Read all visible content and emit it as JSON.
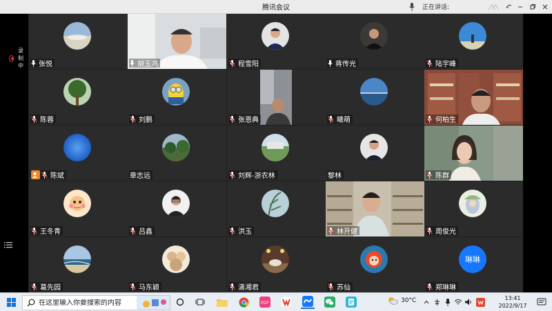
{
  "window": {
    "title": "腾讯会议",
    "speaking_label": "正在讲话:"
  },
  "recording": {
    "label": "录制中"
  },
  "participants": [
    {
      "name": "张悦",
      "mic": "on"
    },
    {
      "name": "胡玉鸿",
      "mic": "on"
    },
    {
      "name": "程雪阳",
      "mic": "muted"
    },
    {
      "name": "蒋传光",
      "mic": "on"
    },
    {
      "name": "陆宇峰",
      "mic": "muted"
    },
    {
      "name": "陈蓉",
      "mic": "muted"
    },
    {
      "name": "刘鹏",
      "mic": "muted"
    },
    {
      "name": "张恩典",
      "mic": "muted"
    },
    {
      "name": "曦萌",
      "mic": "muted"
    },
    {
      "name": "何柏生",
      "mic": "muted"
    },
    {
      "name": "陈斌",
      "mic": "muted"
    },
    {
      "name": "章志远",
      "mic": "none"
    },
    {
      "name": "刘辉-浙农林",
      "mic": "muted"
    },
    {
      "name": "黎林",
      "mic": "none"
    },
    {
      "name": "陈群",
      "mic": "muted"
    },
    {
      "name": "王冬青",
      "mic": "muted"
    },
    {
      "name": "吕鑫",
      "mic": "muted"
    },
    {
      "name": "洪玉",
      "mic": "muted"
    },
    {
      "name": "林开健",
      "mic": "muted"
    },
    {
      "name": "周俊光",
      "mic": "muted"
    },
    {
      "name": "葛先园",
      "mic": "muted"
    },
    {
      "name": "马东颖",
      "mic": "muted"
    },
    {
      "name": "潇湘君",
      "mic": "muted"
    },
    {
      "name": "苏仙",
      "mic": "muted"
    },
    {
      "name": "郑琳琳",
      "mic": "muted",
      "avatar_text": "琳琳"
    }
  ],
  "taskbar": {
    "search_placeholder": "在这里输入你要搜索的内容",
    "pinned_apps": [
      "task-view",
      "file-explorer",
      "chrome",
      "pdf-reader",
      "wps",
      "tencent-meeting",
      "wechat",
      "notes"
    ],
    "weather": "30°C",
    "time": "13:41",
    "date": "2022/9/17"
  },
  "colors": {
    "accent": "#1677ff",
    "muted_mic": "#e03c3c",
    "tile_bg": "#2b2b2b"
  }
}
